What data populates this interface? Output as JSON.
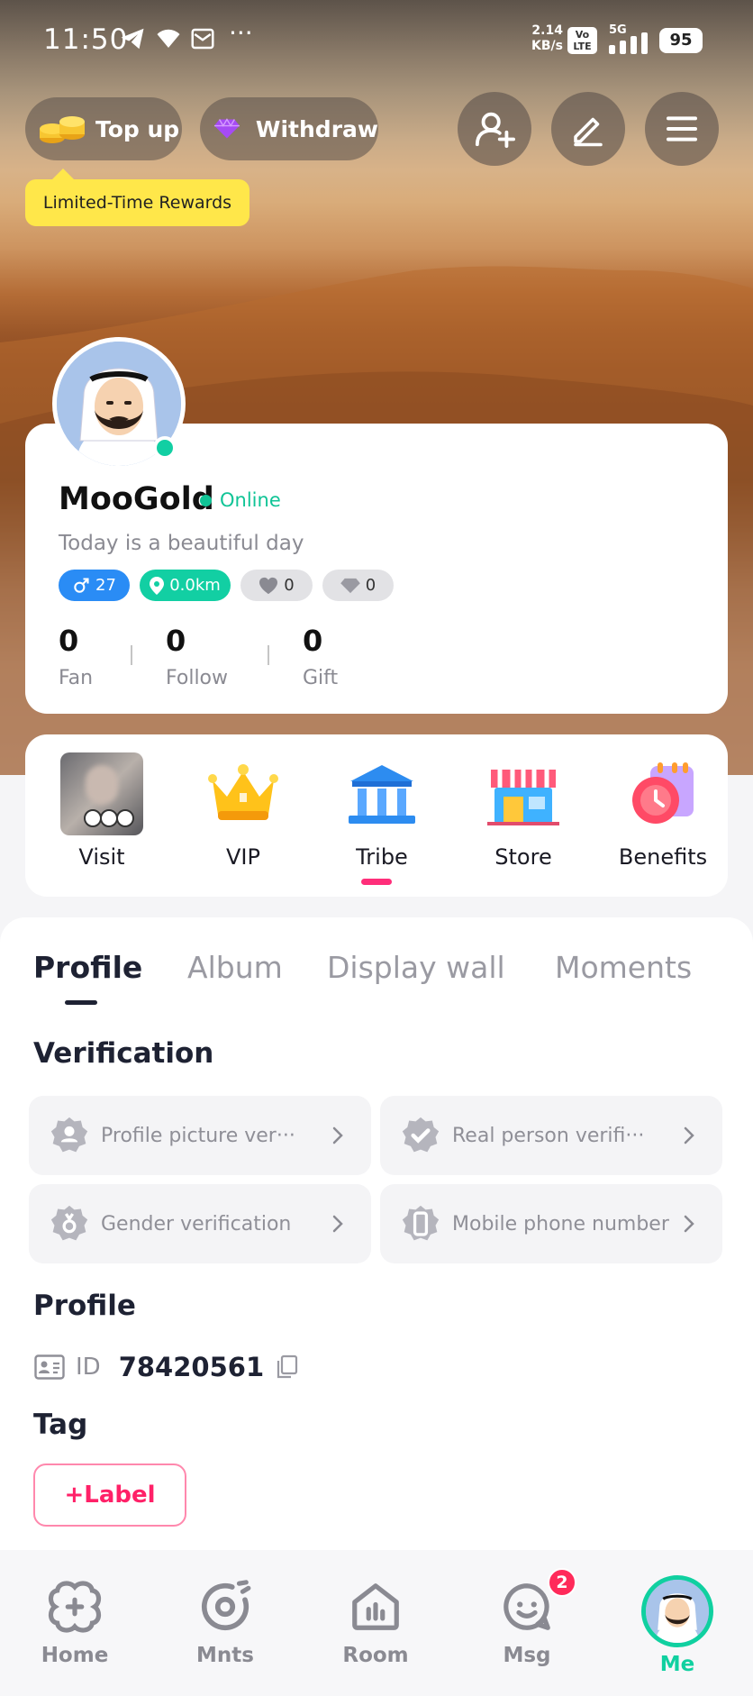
{
  "status_bar": {
    "time": "11:50",
    "speed_value": "2.14",
    "speed_unit": "KB/s",
    "volte_top": "Vo",
    "volte_bottom": "LTE",
    "network": "5G",
    "battery": "95"
  },
  "top_actions": {
    "topup_label": "Top up",
    "withdraw_label": "Withdraw",
    "tooltip": "Limited-Time Rewards"
  },
  "profile": {
    "name": "MooGold",
    "status": "Online",
    "motto": "Today is a beautiful day",
    "chips": {
      "age": "27",
      "distance": "0.0km",
      "likes": "0",
      "diamonds": "0"
    },
    "stats": [
      {
        "value": "0",
        "label": "Fan"
      },
      {
        "value": "0",
        "label": "Follow"
      },
      {
        "value": "0",
        "label": "Gift"
      }
    ]
  },
  "quick_menu": [
    {
      "label": "Visit",
      "icon": "visitor-photo-icon"
    },
    {
      "label": "VIP",
      "icon": "crown-icon"
    },
    {
      "label": "Tribe",
      "icon": "tribe-building-icon"
    },
    {
      "label": "Store",
      "icon": "store-icon"
    },
    {
      "label": "Benefits",
      "icon": "benefits-clock-icon"
    }
  ],
  "tabs": [
    "Profile",
    "Album",
    "Display wall",
    "Moments"
  ],
  "active_tab": "Profile",
  "verification": {
    "title": "Verification",
    "items": [
      "Profile picture ver···",
      "Real person verifi···",
      "Gender verification",
      "Mobile phone number"
    ]
  },
  "profile_section": {
    "title": "Profile",
    "id_label": "ID",
    "id_value": "78420561"
  },
  "tag_section": {
    "title": "Tag",
    "add_label": "+Label"
  },
  "bottom_nav": {
    "items": [
      "Home",
      "Mnts",
      "Room",
      "Msg",
      "Me"
    ],
    "active": "Me",
    "msg_badge": "2"
  },
  "colors": {
    "accent_green": "#10d0a0",
    "accent_pink": "#ff2168",
    "tooltip_yellow": "#ffe74a",
    "male_blue": "#2a8cf5"
  }
}
